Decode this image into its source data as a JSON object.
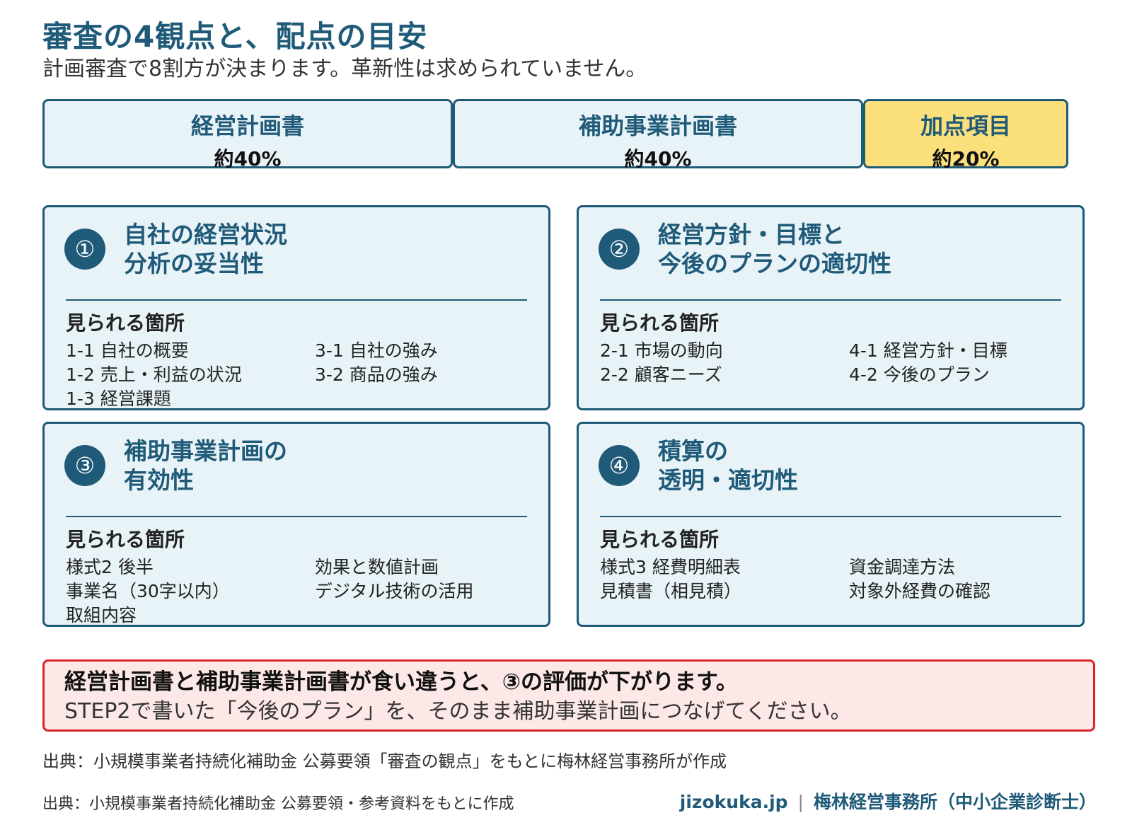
{
  "header": {
    "title": "審査の4観点と、配点の目安",
    "subtitle": "計画審査で8割方が決まります。革新性は求められていません。"
  },
  "weights": [
    {
      "name": "経営計画書",
      "pct": "約40%"
    },
    {
      "name": "補助事業計画書",
      "pct": "約40%"
    },
    {
      "name": "加点項目",
      "pct": "約20%"
    }
  ],
  "panels": [
    {
      "num": "①",
      "title_line1": "自社の経営状況",
      "title_line2": "分析の妥当性",
      "section_label": "見られる箇所",
      "col1": [
        "1-1 自社の概要",
        "1-2 売上・利益の状況",
        "1-3 経営課題"
      ],
      "col2": [
        "3-1 自社の強み",
        "3-2 商品の強み"
      ]
    },
    {
      "num": "②",
      "title_line1": "経営方針・目標と",
      "title_line2": "今後のプランの適切性",
      "section_label": "見られる箇所",
      "col1": [
        "2-1 市場の動向",
        "2-2 顧客ニーズ"
      ],
      "col2": [
        "4-1 経営方針・目標",
        "4-2 今後のプラン"
      ]
    },
    {
      "num": "③",
      "title_line1": "補助事業計画の",
      "title_line2": "有効性",
      "section_label": "見られる箇所",
      "col1": [
        "様式2 後半",
        "事業名（30字以内）",
        "取組内容"
      ],
      "col2": [
        "効果と数値計画",
        "デジタル技術の活用"
      ]
    },
    {
      "num": "④",
      "title_line1": "積算の",
      "title_line2": "透明・適切性",
      "section_label": "見られる箇所",
      "col1": [
        "様式3 経費明細表",
        "見積書（相見積）"
      ],
      "col2": [
        "資金調達方法",
        "対象外経費の確認"
      ]
    }
  ],
  "note": {
    "line1": "経営計画書と補助事業計画書が食い違うと、③の評価が下がります。",
    "line2": "STEP2で書いた「今後のプラン」を、そのまま補助事業計画につなげてください。"
  },
  "sources": {
    "line1": "出典：小規模事業者持続化補助金 公募要領「審査の観点」をもとに梅林経営事務所が作成",
    "line2": "出典：小規模事業者持続化補助金 公募要領・参考資料をもとに作成"
  },
  "footer": {
    "site": "jizokuka.jp",
    "separator": "|",
    "org": "梅林経営事務所（中小企業診断士）"
  },
  "colors": {
    "primary": "#1f5a78",
    "panel_bg": "#e8f3f8",
    "highlight": "#fbe07b",
    "alert_border": "#d9252b",
    "alert_bg": "#fde8e8"
  }
}
